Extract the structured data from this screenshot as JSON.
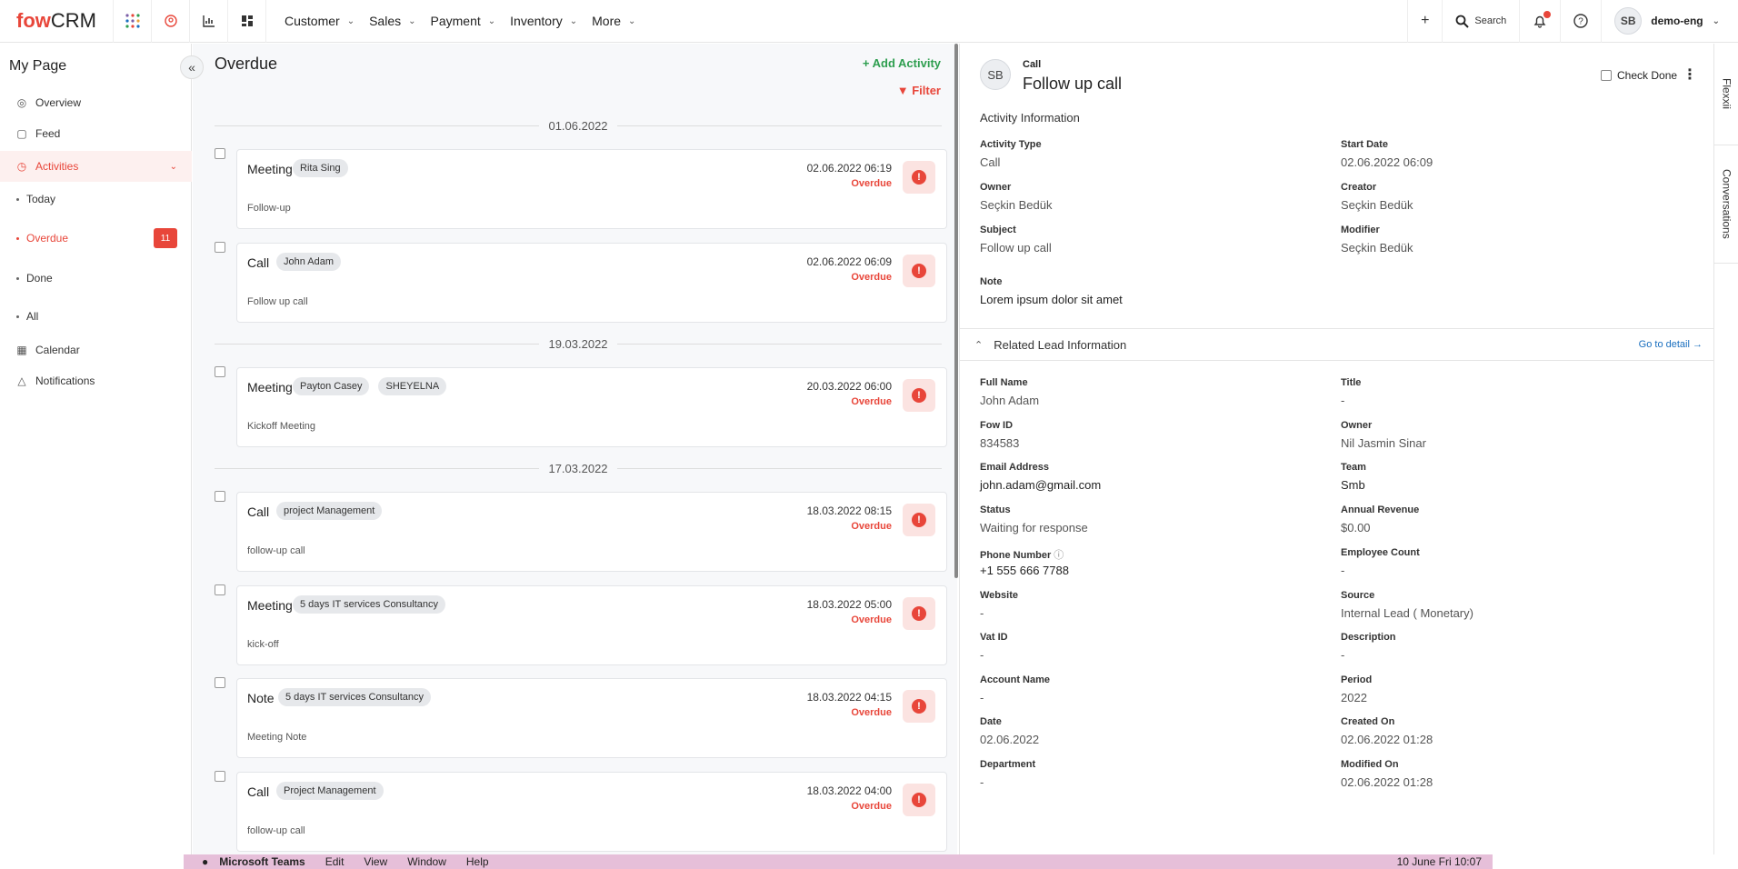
{
  "brand": {
    "logo_main": "fow",
    "logo_sub": "CRM"
  },
  "nav": [
    {
      "label": "Customer"
    },
    {
      "label": "Sales"
    },
    {
      "label": "Payment"
    },
    {
      "label": "Inventory"
    },
    {
      "label": "More"
    }
  ],
  "topbar": {
    "search_label": "Search",
    "user_initials": "SB",
    "user_name": "demo-eng"
  },
  "sidebar": {
    "title": "My Page",
    "items": [
      {
        "label": "Overview"
      },
      {
        "label": "Feed"
      },
      {
        "label": "Activities"
      },
      {
        "label": "Calendar"
      },
      {
        "label": "Notifications"
      }
    ],
    "subitems": [
      {
        "label": "Today"
      },
      {
        "label": "Overdue",
        "badge": "11"
      },
      {
        "label": "Done"
      },
      {
        "label": "All"
      }
    ]
  },
  "list": {
    "title": "Overdue",
    "add_label": "Add Activity",
    "filter_label": "Filter",
    "groups": [
      {
        "date": "01.06.2022"
      },
      {
        "date": "19.03.2022"
      },
      {
        "date": "17.03.2022"
      }
    ],
    "activities": [
      {
        "type": "Meeting",
        "tags": [
          "Rita Sing"
        ],
        "desc": "Follow-up",
        "datetime": "02.06.2022 06:19",
        "status": "Overdue"
      },
      {
        "type": "Call",
        "tags": [
          "John Adam"
        ],
        "desc": "Follow up call",
        "datetime": "02.06.2022 06:09",
        "status": "Overdue"
      },
      {
        "type": "Meeting",
        "tags": [
          "Payton Casey",
          "SHEYELNA"
        ],
        "desc": "Kickoff Meeting",
        "datetime": "20.03.2022 06:00",
        "status": "Overdue"
      },
      {
        "type": "Call",
        "tags": [
          "project Management"
        ],
        "desc": "follow-up call",
        "datetime": "18.03.2022 08:15",
        "status": "Overdue"
      },
      {
        "type": "Meeting",
        "tags": [
          "5 days IT services Consultancy"
        ],
        "desc": "kick-off",
        "datetime": "18.03.2022 05:00",
        "status": "Overdue"
      },
      {
        "type": "Note",
        "tags": [
          "5 days IT services Consultancy"
        ],
        "desc": "Meeting Note",
        "datetime": "18.03.2022 04:15",
        "status": "Overdue"
      },
      {
        "type": "Call",
        "tags": [
          "Project Management"
        ],
        "desc": "follow-up call",
        "datetime": "18.03.2022 04:00",
        "status": "Overdue"
      }
    ]
  },
  "detail": {
    "avatar": "SB",
    "kind": "Call",
    "title": "Follow up call",
    "check_done": "Check Done",
    "section_title": "Activity Information",
    "activity_fields": [
      {
        "label": "Activity Type",
        "value": "Call"
      },
      {
        "label": "Start Date",
        "value": "02.06.2022 06:09"
      },
      {
        "label": "Owner",
        "value": "Seçkin Bedük"
      },
      {
        "label": "Creator",
        "value": "Seçkin Bedük"
      },
      {
        "label": "Subject",
        "value": "Follow up call"
      },
      {
        "label": "Modifier",
        "value": "Seçkin Bedük"
      },
      {
        "label": "Note",
        "value": "Lorem ipsum dolor sit amet"
      }
    ],
    "related_title": "Related Lead Information",
    "go_to_detail": "Go to detail",
    "lead_fields": [
      {
        "label": "Full Name",
        "value": "John Adam"
      },
      {
        "label": "Title",
        "value": "-"
      },
      {
        "label": "Fow ID",
        "value": "834583"
      },
      {
        "label": "Owner",
        "value": "Nil Jasmin Sinar"
      },
      {
        "label": "Email Address",
        "value": "john.adam@gmail.com"
      },
      {
        "label": "Team",
        "value": "Smb"
      },
      {
        "label": "Status",
        "value": "Waiting for response"
      },
      {
        "label": "Annual Revenue",
        "value": "$0.00"
      },
      {
        "label": "Phone Number",
        "value": "+1 555 666 7788"
      },
      {
        "label": "Employee Count",
        "value": "-"
      },
      {
        "label": "Website",
        "value": "-"
      },
      {
        "label": "Source",
        "value": "Internal Lead ( Monetary)"
      },
      {
        "label": "Vat ID",
        "value": "-"
      },
      {
        "label": "Description",
        "value": "-"
      },
      {
        "label": "Account Name",
        "value": "-"
      },
      {
        "label": "Period",
        "value": "2022"
      },
      {
        "label": "Date",
        "value": "02.06.2022"
      },
      {
        "label": "Created On",
        "value": "02.06.2022 01:28"
      },
      {
        "label": "Department",
        "value": "-"
      },
      {
        "label": "Modified On",
        "value": "02.06.2022 01:28"
      }
    ]
  },
  "side_tabs": [
    {
      "label": "Flexxii"
    },
    {
      "label": "Conversations"
    }
  ],
  "macbar": {
    "app": "Microsoft Teams",
    "menus": [
      "Edit",
      "View",
      "Window",
      "Help"
    ],
    "clock": "10 June Fri 10:07"
  },
  "colors": {
    "accent": "#e8463a",
    "green": "#2e9e4f",
    "link": "#1a6fbf"
  }
}
